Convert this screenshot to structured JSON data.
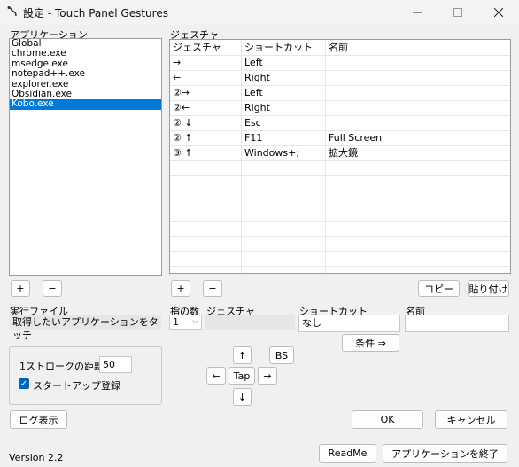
{
  "window": {
    "title": "設定 - Touch Panel Gestures",
    "minimize_icon": "minimize-icon",
    "maximize_icon": "maximize-icon",
    "close_icon": "close-icon"
  },
  "apps": {
    "label": "アプリケーション",
    "items": [
      "Global",
      "chrome.exe",
      "msedge.exe",
      "notepad++.exe",
      "explorer.exe",
      "Obsidian.exe",
      "Kobo.exe"
    ],
    "selected": "Kobo.exe",
    "add_label": "+",
    "remove_label": "−"
  },
  "gestures": {
    "label": "ジェスチャ",
    "columns": [
      "ジェスチャ",
      "ショートカット",
      "名前"
    ],
    "rows": [
      [
        "→",
        "Left",
        ""
      ],
      [
        "←",
        "Right",
        ""
      ],
      [
        "②→",
        "Left",
        ""
      ],
      [
        "②←",
        "Right",
        ""
      ],
      [
        "② ↓",
        "Esc",
        ""
      ],
      [
        "② ↑",
        "F11",
        "Full Screen"
      ],
      [
        "③ ↑",
        "Windows+;",
        "拡大鏡"
      ]
    ],
    "add_label": "+",
    "remove_label": "−",
    "copy_label": "コピー",
    "paste_label": "貼り付け"
  },
  "exec": {
    "label": "実行ファイル",
    "value": "取得したいアプリケーションをタッチ"
  },
  "editor": {
    "fingers_label": "指の数",
    "fingers_value": "1",
    "gesture_label": "ジェスチャ",
    "gesture_value": "",
    "shortcut_label": "ショートカット",
    "shortcut_value": "なし",
    "name_label": "名前",
    "name_value": "",
    "condition_label": "条件 ⇒",
    "up": "↑",
    "down": "↓",
    "left": "←",
    "right": "→",
    "tap": "Tap",
    "bs": "BS"
  },
  "settings": {
    "stroke_label": "1ストロークの距離 :",
    "stroke_value": "50",
    "startup_label": "スタートアップ登録",
    "startup_checked": true
  },
  "footer": {
    "log_label": "ログ表示",
    "ok_label": "OK",
    "cancel_label": "キャンセル",
    "version": "Version 2.2",
    "readme_label": "ReadMe",
    "exit_label": "アプリケーションを終了"
  }
}
